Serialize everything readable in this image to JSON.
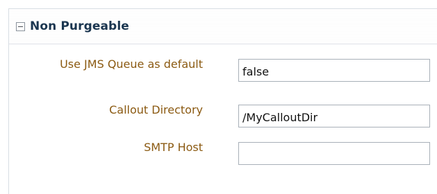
{
  "section": {
    "title": "Non Purgeable"
  },
  "fields": [
    {
      "label": "Use JMS Queue as default",
      "value": "false"
    },
    {
      "label": "Callout Directory",
      "value": "/MyCalloutDir"
    },
    {
      "label": "SMTP Host",
      "value": ""
    }
  ]
}
